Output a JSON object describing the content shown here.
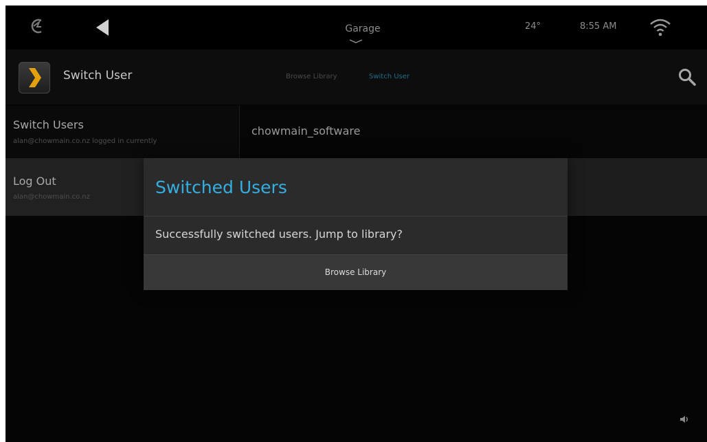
{
  "statusbar": {
    "room": "Garage",
    "temperature": "24°",
    "time": "8:55 AM",
    "icons": {
      "home": "control4-logo-icon",
      "back": "back-arrow-icon",
      "room_menu": "chevron-down-icon",
      "wifi": "wifi-icon"
    }
  },
  "appbar": {
    "title": "Switch User",
    "app_icon": "plex-icon",
    "breadcrumbs": [
      "Browse Library",
      "Switch User"
    ],
    "search_icon": "search-icon"
  },
  "menu": {
    "items": [
      {
        "title": "Switch Users",
        "subtitle": "alan@chowmain.co.nz logged in currently"
      },
      {
        "title": "Log Out",
        "subtitle": "alan@chowmain.co.nz"
      }
    ]
  },
  "accounts": [
    "chowmain_software"
  ],
  "dialog": {
    "title": "Switched Users",
    "message": "Successfully switched users.  Jump to library?",
    "button": "Browse Library"
  },
  "colors": {
    "accent": "#35aee2",
    "crumb_active": "#1e6f8a",
    "background": "#050505",
    "dialog": "#2b2b2b"
  }
}
